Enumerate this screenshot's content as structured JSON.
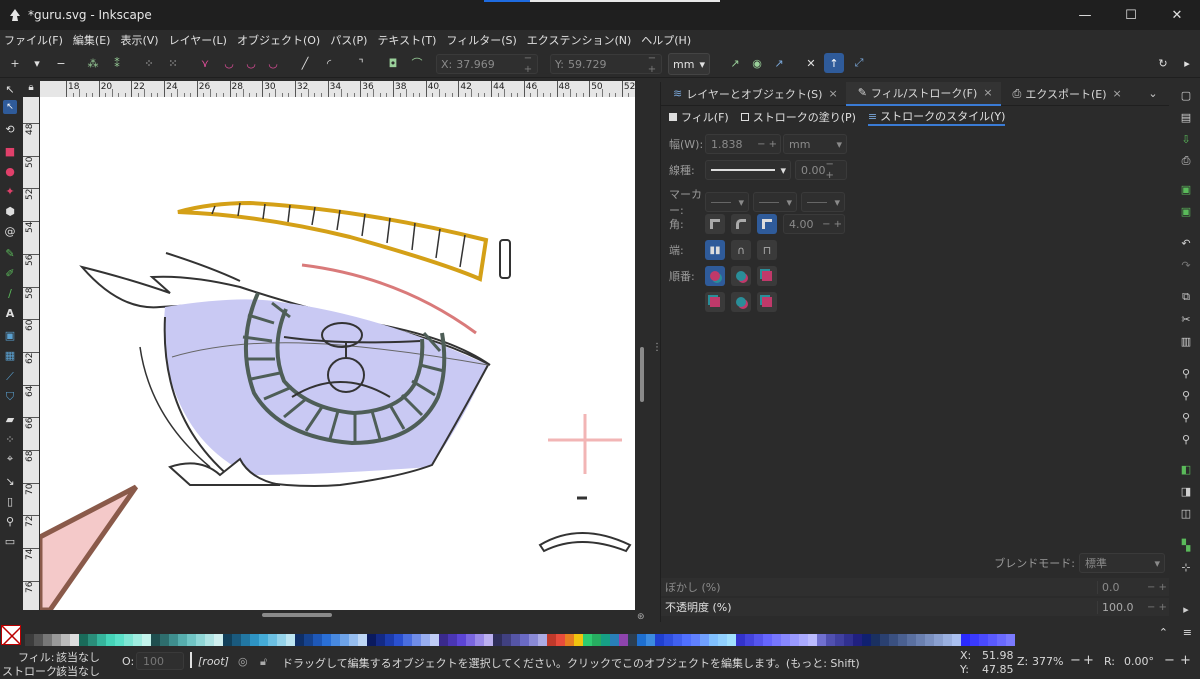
{
  "window": {
    "title": "*guru.svg - Inkscape",
    "minimize_icon": "minimize-icon",
    "maximize_icon": "maximize-icon",
    "close_icon": "close-icon"
  },
  "menu": [
    "ファイル(F)",
    "編集(E)",
    "表示(V)",
    "レイヤー(L)",
    "オブジェクト(O)",
    "パス(P)",
    "テキスト(T)",
    "フィルター(S)",
    "エクステンション(N)",
    "ヘルプ(H)"
  ],
  "toolbar": {
    "x_label": "X:",
    "x_value": "37.969",
    "y_label": "Y:",
    "y_value": "59.729",
    "unit": "mm",
    "plusminus": "− +"
  },
  "ruler": {
    "h_ticks": [
      "18",
      "20",
      "22",
      "24",
      "26",
      "28",
      "30",
      "32",
      "34",
      "36",
      "38",
      "40",
      "42",
      "44",
      "46",
      "48",
      "50",
      "52"
    ],
    "v_ticks": [
      "48",
      "50",
      "52",
      "54",
      "56",
      "58",
      "60",
      "62",
      "64",
      "66",
      "68",
      "70",
      "72",
      "74",
      "76",
      "78"
    ]
  },
  "panel": {
    "tabs": [
      {
        "label": "レイヤーとオブジェクト(S)",
        "close": "×"
      },
      {
        "label": "フィル/ストローク(F)",
        "close": "×"
      },
      {
        "label": "エクスポート(E)",
        "close": "×"
      }
    ],
    "subtabs": [
      "フィル(F)",
      "ストロークの塗り(P)",
      "ストロークのスタイル(Y)"
    ],
    "width_label": "幅(W):",
    "width_value": "1.838",
    "width_unit": "mm",
    "dash_label": "線種:",
    "dash_offset": "0.00",
    "marker_label": "マーカー:",
    "corner_label": "角:",
    "miter_value": "4.00",
    "cap_label": "端:",
    "order_label": "順番:",
    "blend_label": "ブレンドモード:",
    "blend_value": "標準",
    "blur_label": "ぼかし (%)",
    "blur_value": "0.0",
    "opacity_label": "不透明度 (%)",
    "opacity_value": "100.0"
  },
  "status": {
    "fill_label": "フィル:",
    "fill_value": "該当なし",
    "stroke_label": "ストローク:",
    "stroke_value": "該当なし",
    "o_label": "O:",
    "o_value": "100",
    "layer": "[root]",
    "message": "ドラッグして編集するオブジェクトを選択してください。クリックでこのオブジェクトを編集します。(もっと: Shift)",
    "x_label": "X:",
    "x_value": "51.98",
    "y_label": "Y:",
    "y_value": "47.85",
    "z_label": "Z:",
    "zoom": "377%",
    "r_label": "R:",
    "rotation": "0.00°"
  },
  "colors": {
    "accent": "#3a7bd5",
    "bg": "#2b2b2b",
    "canvas": "#ffffff"
  }
}
